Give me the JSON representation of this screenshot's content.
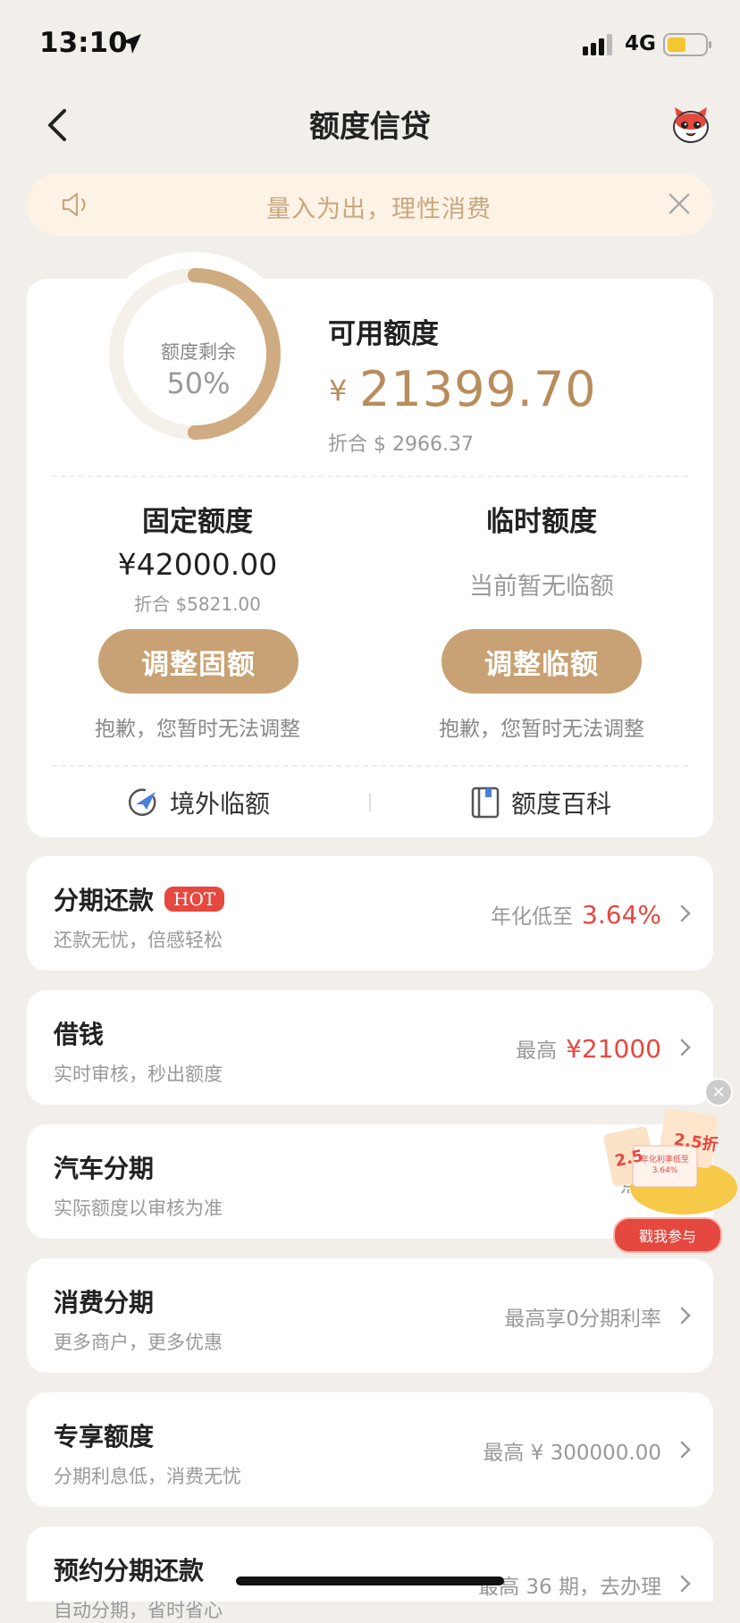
{
  "status_bar": {
    "time": "13:10",
    "network": "4G"
  },
  "nav": {
    "title": "额度信贷"
  },
  "notice": {
    "text": "量入为出，理性消费"
  },
  "credit": {
    "ring_label": "额度剩余",
    "ring_percent": "50%",
    "remaining_fraction": 0.5,
    "available_title": "可用额度",
    "currency_symbol": "¥",
    "available_amount": "21399.70",
    "available_usd": "折合 $ 2966.37",
    "fixed": {
      "title": "固定额度",
      "amount": "¥42000.00",
      "usd": "折合 $5821.00",
      "button": "调整固额",
      "note": "抱歉，您暂时无法调整"
    },
    "temp": {
      "title": "临时额度",
      "status": "当前暂无临额",
      "button": "调整临额",
      "note": "抱歉，您暂时无法调整"
    },
    "links": {
      "overseas": "境外临额",
      "wiki": "额度百科"
    }
  },
  "rows": [
    {
      "title": "分期还款",
      "badge": "HOT",
      "sub": "还款无忧，倍感轻松",
      "right_label": "年化低至",
      "right_value": "3.64%"
    },
    {
      "title": "借钱",
      "sub": "实时审核，秒出额度",
      "right_label": "最高",
      "right_value": "¥21000"
    },
    {
      "title": "汽车分期",
      "sub": "实际额度以审核为准",
      "right_label": "点击"
    },
    {
      "title": "消费分期",
      "sub": "更多商户，更多优惠",
      "right_label": "最高享0分期利率"
    },
    {
      "title": "专享额度",
      "sub": "分期利息低，消费无忧",
      "right_label": "最高 ¥ 300000.00"
    },
    {
      "title": "预约分期还款",
      "sub": "自动分期，省时省心",
      "right_label": "最高 36 期，去办理"
    }
  ],
  "promo": {
    "tag1": "2.5",
    "tag2": "2.5折",
    "ticket": "年化利率低至 3.64%",
    "button": "戳我参与"
  },
  "colors": {
    "accent": "#c8a274",
    "gold_text": "#b88d5d",
    "red": "#e5483f",
    "bg": "#f2eee9"
  }
}
